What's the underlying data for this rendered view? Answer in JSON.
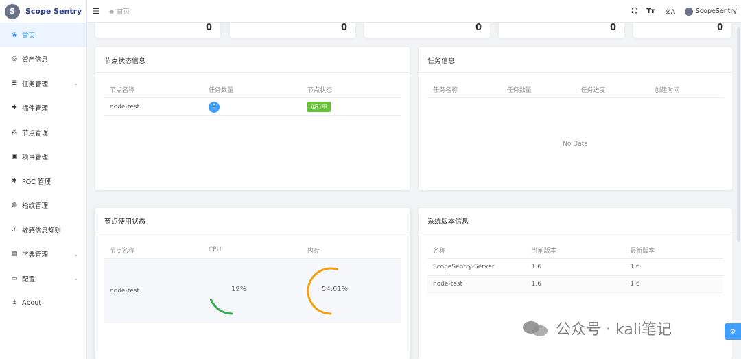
{
  "app": {
    "name": "Scope Sentry",
    "logo_letter": "S"
  },
  "sidebar": {
    "items": [
      {
        "label": "首页",
        "icon": "dashboard-icon",
        "glyph": "◉",
        "active": true
      },
      {
        "label": "资产信息",
        "icon": "eye-icon",
        "glyph": "◎"
      },
      {
        "label": "任务管理",
        "icon": "list-icon",
        "glyph": "☰",
        "expandable": true
      },
      {
        "label": "插件管理",
        "icon": "puzzle-icon",
        "glyph": "✚"
      },
      {
        "label": "节点管理",
        "icon": "nodes-icon",
        "glyph": "⁂"
      },
      {
        "label": "项目管理",
        "icon": "project-icon",
        "glyph": "▣"
      },
      {
        "label": "POC 管理",
        "icon": "bug-icon",
        "glyph": "✱"
      },
      {
        "label": "指纹管理",
        "icon": "fingerprint-icon",
        "glyph": "◍"
      },
      {
        "label": "敏感信息规则",
        "icon": "anchor-icon",
        "glyph": "⚓"
      },
      {
        "label": "字典管理",
        "icon": "book-icon",
        "glyph": "▤",
        "expandable": true
      },
      {
        "label": "配置",
        "icon": "monitor-icon",
        "glyph": "▭",
        "expandable": true
      },
      {
        "label": "About",
        "icon": "anchor-icon",
        "glyph": "⚓"
      }
    ]
  },
  "topbar": {
    "breadcrumb": "首页",
    "user_name": "ScopeSentry",
    "fullscreen_glyph": "⛶",
    "font_size_glyph": "Tт",
    "language_glyph": "文A"
  },
  "stats": [
    "0",
    "0",
    "0",
    "0",
    "0"
  ],
  "node_status": {
    "title": "节点状态信息",
    "columns": [
      "节点名称",
      "任务数量",
      "节点状态"
    ],
    "rows": [
      {
        "name": "node-test",
        "tasks": "0",
        "status": "运行中"
      }
    ]
  },
  "task_info": {
    "title": "任务信息",
    "columns": [
      "任务名称",
      "任务数量",
      "任务进度",
      "创建时间"
    ],
    "empty_text": "No Data"
  },
  "node_usage": {
    "title": "节点使用状态",
    "columns": [
      "节点名称",
      "CPU",
      "内存"
    ],
    "rows": [
      {
        "name": "node-test",
        "cpu_label": "19%",
        "cpu": 0.19,
        "mem_label": "54.61%",
        "mem": 0.5461
      }
    ],
    "colors": {
      "cpu": "#34a853",
      "mem": "#f59e0b"
    }
  },
  "version_info": {
    "title": "系统版本信息",
    "columns": [
      "名称",
      "当前版本",
      "最新版本"
    ],
    "rows": [
      {
        "name": "ScopeSentry-Server",
        "current": "1.6",
        "latest": "1.6"
      },
      {
        "name": "node-test",
        "current": "1.6",
        "latest": "1.6"
      }
    ]
  },
  "watermark": "公众号 · kali笔记"
}
